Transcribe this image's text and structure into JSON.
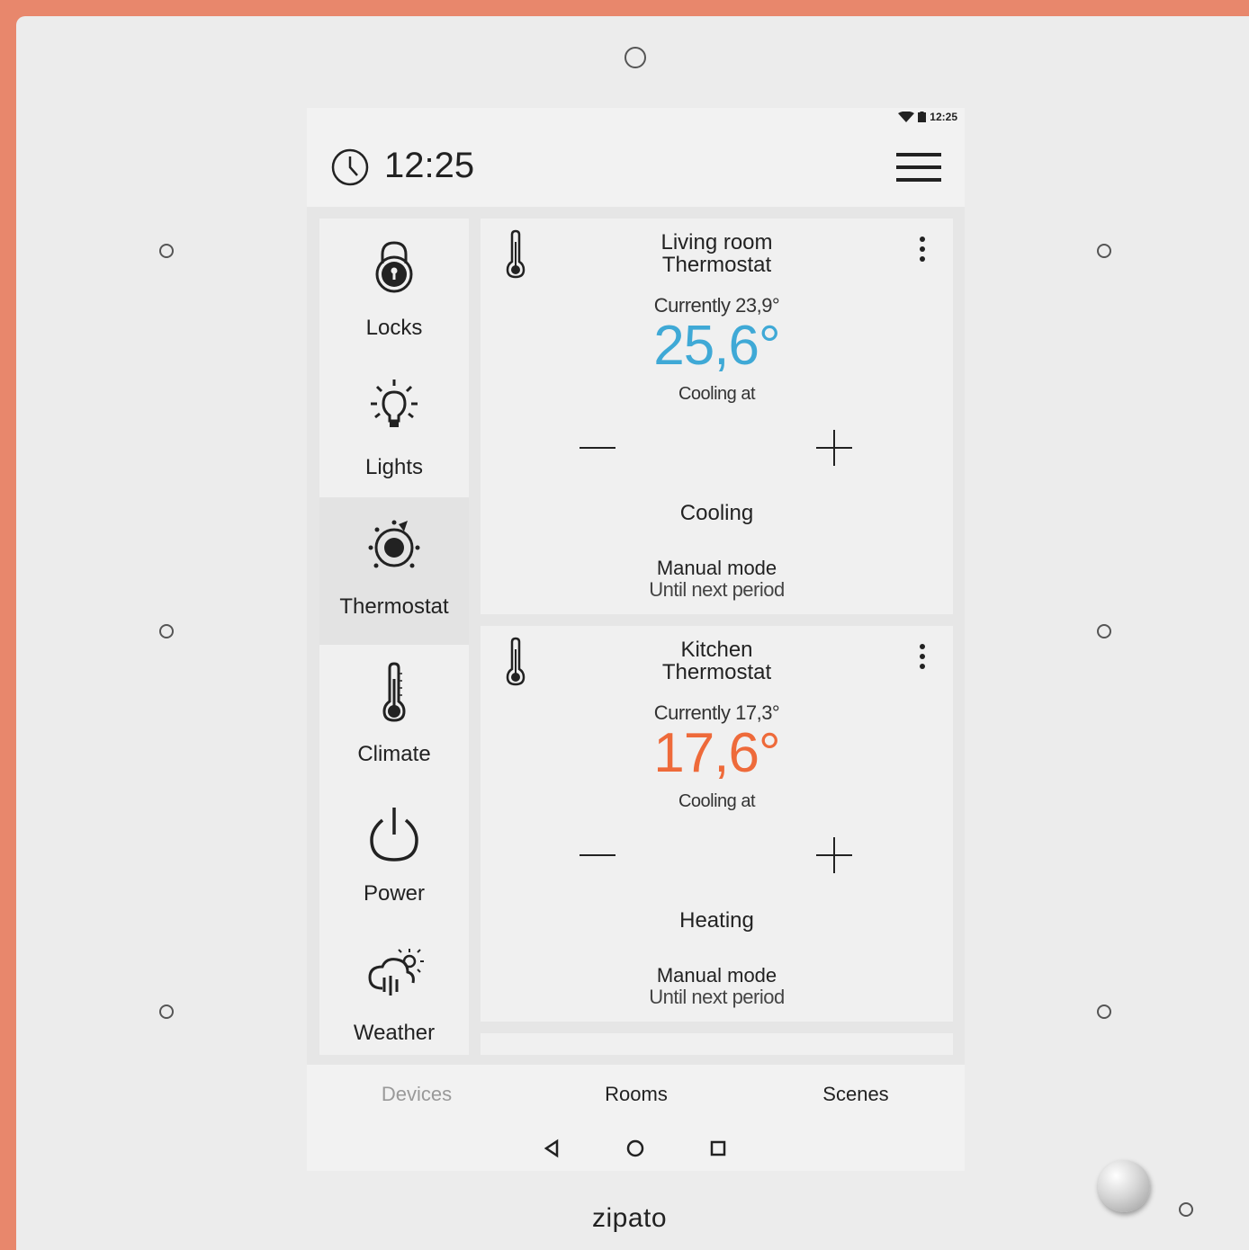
{
  "status_bar": {
    "time": "12:25"
  },
  "header": {
    "time_hours": "12",
    "time_sep": ":",
    "time_minutes": "25"
  },
  "sidebar": {
    "items": [
      {
        "label": "Locks",
        "icon": "lock-icon"
      },
      {
        "label": "Lights",
        "icon": "lightbulb-icon"
      },
      {
        "label": "Thermostat",
        "icon": "thermostat-icon",
        "active": true
      },
      {
        "label": "Climate",
        "icon": "thermometer-icon"
      },
      {
        "label": "Power",
        "icon": "power-icon"
      },
      {
        "label": "Weather",
        "icon": "weather-icon"
      }
    ]
  },
  "thermostats": [
    {
      "title_line1": "Living room",
      "title_line2": "Thermostat",
      "current": "Currently 23,9°",
      "setpoint": "25,6°",
      "setpoint_color": "#3fa9d6",
      "cooling_at": "Cooling at",
      "mode": "Cooling",
      "manual": "Manual mode",
      "until": "Until next period"
    },
    {
      "title_line1": "Kitchen",
      "title_line2": "Thermostat",
      "current": "Currently 17,3°",
      "setpoint": "17,6°",
      "setpoint_color": "#ee6a3a",
      "cooling_at": "Cooling at",
      "mode": "Heating",
      "manual": "Manual mode",
      "until": "Until next period"
    }
  ],
  "tabs": {
    "devices": "Devices",
    "rooms": "Rooms",
    "scenes": "Scenes"
  },
  "device": {
    "brand": "zipato"
  },
  "colors": {
    "frame": "#e8876c",
    "panel": "#ececec",
    "accent_cool": "#3fa9d6",
    "accent_heat": "#ee6a3a"
  }
}
